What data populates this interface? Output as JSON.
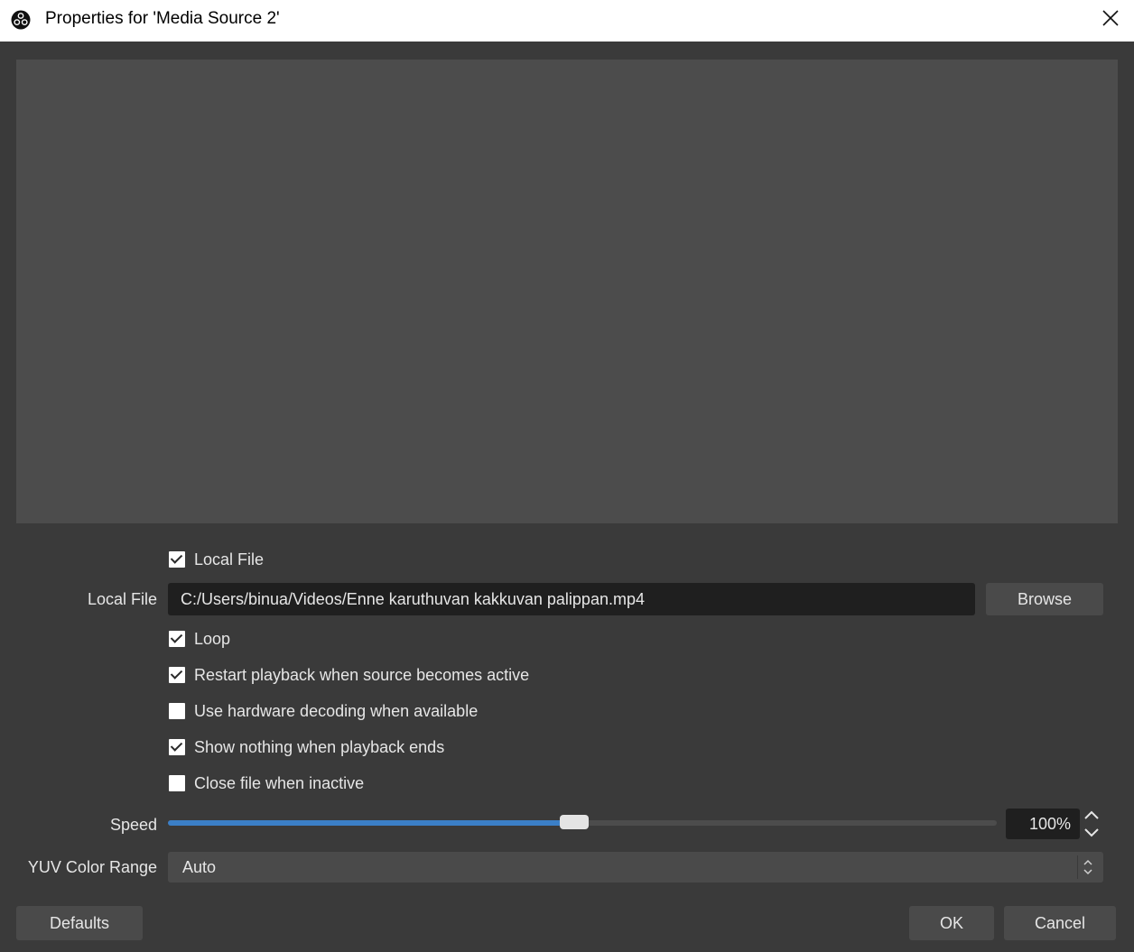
{
  "window": {
    "title": "Properties for 'Media Source 2'"
  },
  "local_file_toggle": {
    "label": "Local File",
    "checked": true
  },
  "local_file": {
    "label": "Local File",
    "path": "C:/Users/binua/Videos/Enne karuthuvan kakkuvan palippan.mp4",
    "browse_label": "Browse"
  },
  "options": [
    {
      "label": "Loop",
      "checked": true
    },
    {
      "label": "Restart playback when source becomes active",
      "checked": true
    },
    {
      "label": "Use hardware decoding when available",
      "checked": false
    },
    {
      "label": "Show nothing when playback ends",
      "checked": true
    },
    {
      "label": "Close file when inactive",
      "checked": false
    }
  ],
  "speed": {
    "label": "Speed",
    "value_text": "100%",
    "fraction": 0.49
  },
  "yuv": {
    "label": "YUV Color Range",
    "value": "Auto"
  },
  "footer": {
    "defaults_label": "Defaults",
    "ok_label": "OK",
    "cancel_label": "Cancel"
  },
  "colors": {
    "background": "#3a3a3a",
    "preview": "#4c4c4c",
    "accent": "#3b7fc7"
  }
}
